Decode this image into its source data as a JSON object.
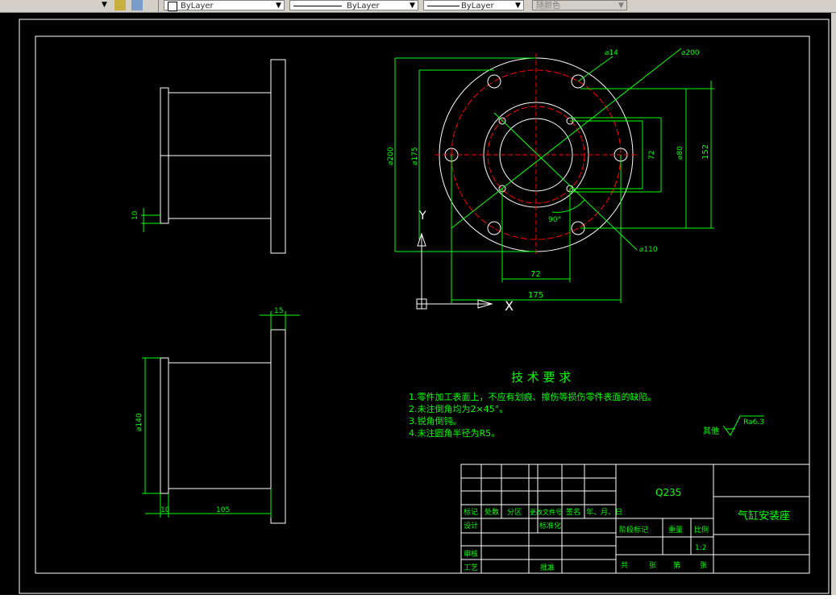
{
  "toolbar": {
    "layer_label": "ByLayer",
    "linetype_label": "ByLayer",
    "lineweight_label": "ByLayer",
    "color_label": "随颜色"
  },
  "drawing": {
    "dims_top": {
      "d14": "⌀14",
      "d200": "⌀200",
      "d110": "⌀110",
      "d175_left": "⌀175",
      "d200_left": "⌀200",
      "d72_v": "72",
      "d80": "⌀80",
      "d152": "152",
      "d72_h": "72",
      "d175_h": "175",
      "angle": "90°"
    },
    "axis_y": "Y",
    "axis_x": "X",
    "dims_side": {
      "d10_top": "10",
      "d15": "15",
      "d140": "⌀140",
      "d10_bottom": "10",
      "d105": "105"
    },
    "tech_title": "技 术 要 求",
    "tech_items": [
      "1.零件加工表面上，不应有划痕、擦伤等损伤零件表面的缺陷。",
      "2.未注倒角均为2×45°。",
      "3.锐角倒钝。",
      "4.未注圆角半径为R5。"
    ],
    "roughness_prefix": "其他",
    "roughness_value": "Ra6.3",
    "title_block": {
      "material": "Q235",
      "part_name": "气缸安装座",
      "scale": "1:2",
      "hdr": [
        "标记",
        "处数",
        "分区",
        "更改文件号",
        "签名",
        "年、月、日"
      ],
      "design": "设计",
      "standardize": "标准化",
      "stage": "阶段标记",
      "weight": "重量",
      "scale_label": "比例",
      "review": "审核",
      "process": "工艺",
      "approve": "批准",
      "total": "共",
      "sheet1": "张",
      "page": "第",
      "sheet2": "张"
    }
  }
}
